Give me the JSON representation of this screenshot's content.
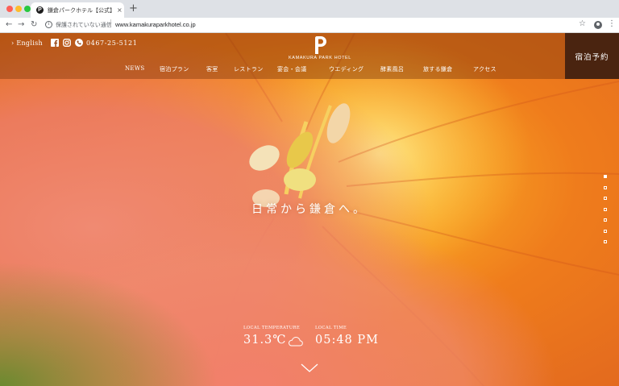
{
  "browser": {
    "tab_title": "鎌倉パークホテル【公式】| KAMAKURA",
    "tab_close": "×",
    "new_tab": "+",
    "security_label": "保護されていない通信",
    "url": "www.kamakuraparkhotel.co.jp",
    "favicon_letter": "P"
  },
  "header": {
    "language_link": "› English",
    "phone": "0467-25-5121",
    "logo_text": "KAMAKURA PARK HOTEL",
    "reserve_button": "宿泊予約",
    "nav": [
      {
        "label": "NEWS"
      },
      {
        "label": "宿泊プラン"
      },
      {
        "label": "客室"
      },
      {
        "label": "レストラン"
      },
      {
        "label": "宴会・会議"
      },
      {
        "label": "ウエディング"
      },
      {
        "label": "酵素風呂"
      },
      {
        "label": "旅する鎌倉"
      },
      {
        "label": "アクセス"
      }
    ]
  },
  "hero": {
    "tagline": "日常から鎌倉へ。",
    "slides_total": 7,
    "slides_active": 1
  },
  "weather": {
    "temperature_label": "LOCAL TEMPERATURE",
    "temperature_value": "31.3℃",
    "time_label": "LOCAL TIME",
    "time_value": "05:48 PM",
    "condition_icon": "cloud-icon"
  },
  "colors": {
    "header_overlay": "#78320a",
    "reserve_bg": "#4a2410",
    "petal_orange": "#f08a20"
  }
}
